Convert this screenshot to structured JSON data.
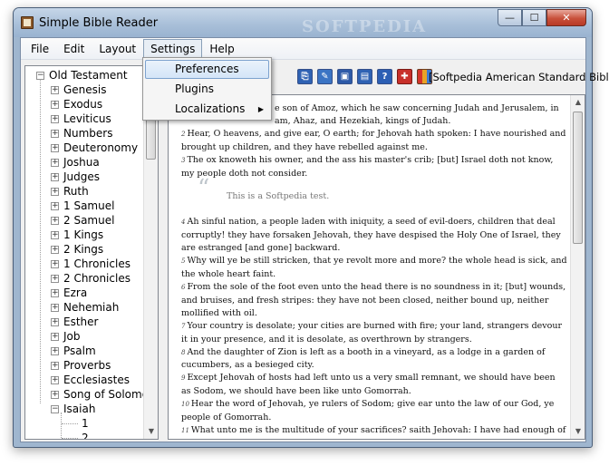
{
  "window": {
    "title": "Simple Bible Reader",
    "minimize_glyph": "—",
    "maximize_glyph": "☐",
    "close_glyph": "✕"
  },
  "watermark": "SOFTPEDIA",
  "menu": {
    "items": [
      "File",
      "Edit",
      "Layout",
      "Settings",
      "Help"
    ],
    "open": "Settings"
  },
  "settings_menu": {
    "items": [
      "Preferences",
      "Plugins",
      "Localizations"
    ],
    "highlighted": "Preferences",
    "submenu_arrow": "▶"
  },
  "tree": {
    "root": "Old Testament",
    "books": [
      "Genesis",
      "Exodus",
      "Leviticus",
      "Numbers",
      "Deuteronomy",
      "Joshua",
      "Judges",
      "Ruth",
      "1 Samuel",
      "2 Samuel",
      "1 Kings",
      "2 Kings",
      "1 Chronicles",
      "2 Chronicles",
      "Ezra",
      "Nehemiah",
      "Esther",
      "Job",
      "Psalm",
      "Proverbs",
      "Ecclesiastes",
      "Song of Solomon",
      "Isaiah"
    ],
    "expanded_book": "Isaiah",
    "chapters": [
      "1",
      "2"
    ]
  },
  "toolbar": {
    "info_text": "[Softpedia American Standard Bible] Is",
    "icons": [
      "copy-icon",
      "edit-icon",
      "save-icon",
      "print-icon",
      "help-icon",
      "bookmark-icon",
      "library-icon"
    ]
  },
  "reader": {
    "verse1_fragment_a": "e son of Amoz, which he saw concerning Judah and Jerusalem, in",
    "verse1_fragment_b": "am, Ahaz, and Hezekiah, kings of Judah.",
    "quote": "This is a Softpedia test.",
    "verses": [
      {
        "n": "2",
        "text": "Hear, O heavens, and give ear, O earth; for Jehovah hath spoken: I have nourished and brought up children, and they have rebelled against me."
      },
      {
        "n": "3",
        "text": "The ox knoweth his owner, and the ass his master's crib; [but] Israel doth not know, my people doth not consider."
      },
      {
        "n": "4",
        "text": "Ah sinful nation, a people laden with iniquity, a seed of evil-doers, children that deal corruptly! they have forsaken Jehovah, they have despised the Holy One of Israel, they are estranged [and gone] backward."
      },
      {
        "n": "5",
        "text": "Why will ye be still stricken, that ye revolt more and more? the whole head is sick, and the whole heart faint."
      },
      {
        "n": "6",
        "text": "From the sole of the foot even unto the head there is no soundness in it; [but] wounds, and bruises, and fresh stripes: they have not been closed, neither bound up, neither mollified with oil."
      },
      {
        "n": "7",
        "text": "Your country is desolate; your cities are burned with fire; your land, strangers devour it in your presence, and it is desolate, as overthrown by strangers."
      },
      {
        "n": "8",
        "text": "And the daughter of Zion is left as a booth in a vineyard, as a lodge in a garden of cucumbers, as a besieged city."
      },
      {
        "n": "9",
        "text": "Except Jehovah of hosts had left unto us a very small remnant, we should have been as Sodom, we should have been like unto Gomorrah."
      },
      {
        "n": "10",
        "text": "Hear the word of Jehovah, ye rulers of Sodom; give ear unto the law of our God, ye people of Gomorrah."
      },
      {
        "n": "11",
        "text": "What unto me is the multitude of your sacrifices? saith Jehovah: I have had enough of the burnt-offerings of rams, and the fat of fed beasts; and I delight not in the blood of bullocks,"
      }
    ]
  },
  "colors": {
    "accent": "#3a6fb7",
    "title_bar": "#a7bed8",
    "menu_highlight": "#d4e5f8"
  }
}
